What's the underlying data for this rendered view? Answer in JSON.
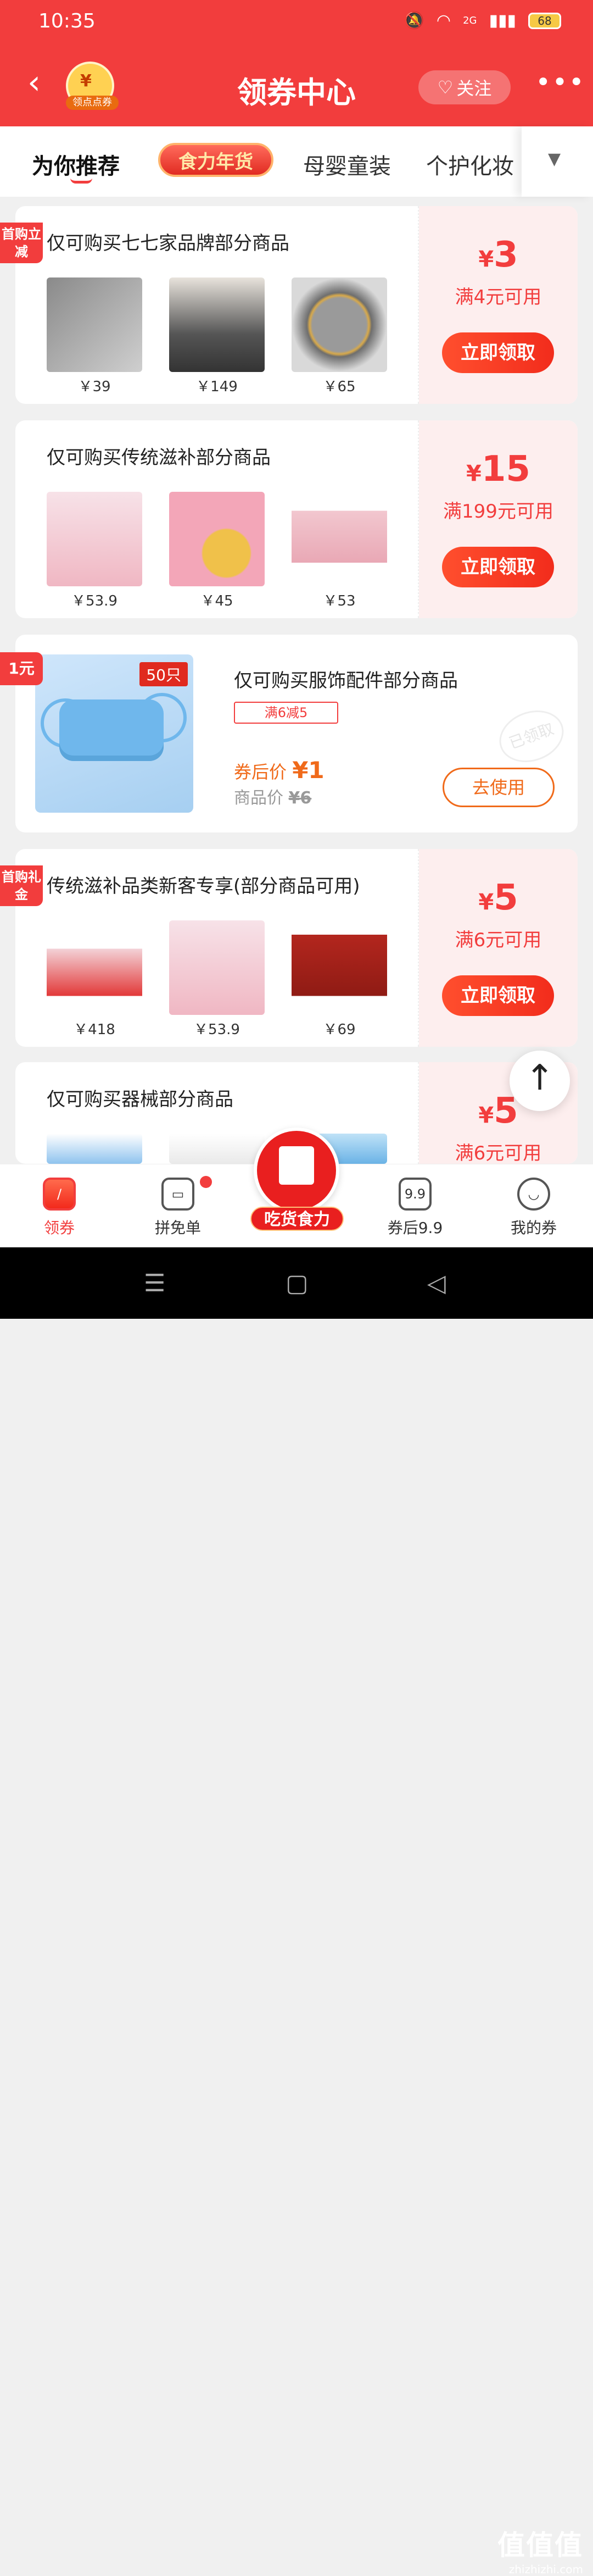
{
  "status": {
    "time": "10:35",
    "battery": "68",
    "signal": "2G"
  },
  "nav": {
    "title": "领券中心",
    "logo_label": "领点点券",
    "follow_label": "关注"
  },
  "tabs": [
    {
      "label": "为你推荐",
      "active": true
    },
    {
      "label": "食力年货",
      "badge": true
    },
    {
      "label": "母婴童装"
    },
    {
      "label": "个护化妆"
    }
  ],
  "coupons": [
    {
      "tag": "首购立减",
      "title": "仅可购买七七家品牌部分商品",
      "currency": "¥",
      "amount": "3",
      "condition": "满4元可用",
      "button": "立即领取",
      "products": [
        {
          "price": "￥39"
        },
        {
          "price": "￥149"
        },
        {
          "price": "￥65"
        }
      ]
    },
    {
      "tag": "",
      "title": "仅可购买传统滋补部分商品",
      "currency": "¥",
      "amount": "15",
      "condition": "满199元可用",
      "button": "立即领取",
      "products": [
        {
          "price": "￥53.9"
        },
        {
          "price": "￥45"
        },
        {
          "price": "￥53"
        }
      ]
    },
    {
      "tag": "首购礼金",
      "title": "传统滋补品类新客专享(部分商品可用)",
      "currency": "¥",
      "amount": "5",
      "condition": "满6元可用",
      "button": "立即领取",
      "products": [
        {
          "price": "￥418"
        },
        {
          "price": "￥53.9"
        },
        {
          "price": "￥69"
        }
      ]
    },
    {
      "tag": "",
      "title": "仅可购买器械部分商品",
      "currency": "¥",
      "amount": "5",
      "condition": "满6元可用",
      "button": "",
      "products": []
    }
  ],
  "mask_coupon": {
    "tag": "1元",
    "count": "50只",
    "title": "仅可购买服饰配件部分商品",
    "discount": "满6减5",
    "after_label": "券后价",
    "after_price": "¥1",
    "orig_label": "商品价",
    "orig_price": "¥6",
    "button": "去使用",
    "stamp": "已领取"
  },
  "bottom_nav": [
    {
      "label": "领券",
      "active": true
    },
    {
      "label": "拼免单"
    },
    {
      "label": "吃货食力"
    },
    {
      "label": "券后9.9"
    },
    {
      "label": "我的券"
    }
  ],
  "watermark": {
    "big": "值值值",
    "small": "zhizhizhi.com"
  },
  "colors": {
    "primary": "#f23d3d",
    "accent": "#f06a1a"
  }
}
